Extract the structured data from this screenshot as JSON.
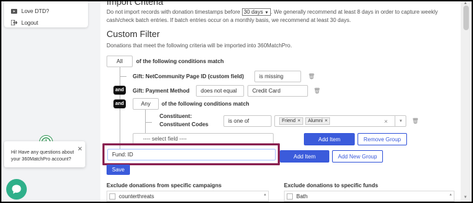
{
  "nav": {
    "love_label": "Love DTD?",
    "logout_label": "Logout"
  },
  "chat": {
    "message": "Hi! Have any questions about your 360MatchPro account?",
    "close_glyph": "✕"
  },
  "import_criteria": {
    "title": "Import Criteria",
    "text_before": "Do not import records with donation timestamps before",
    "days_select": "30 days",
    "text_after": ". We generally recommend at least 8 days in order to capture weekly cash/check batch entries. If batch entries occur on a monthly basis, we recommend at least 30 days."
  },
  "custom_filter": {
    "title": "Custom Filter",
    "description": "Donations that meet the following criteria will be imported into 360MatchPro.",
    "match_select": "All",
    "match_suffix": "of the following conditions match",
    "cond1": {
      "label": "Gift: NetCommunity Page ID (custom field)",
      "operator": "is missing"
    },
    "cond2": {
      "and_label": "and",
      "label": "Gift: Payment Method",
      "operator": "does not equal",
      "value": "Credit Card"
    },
    "group": {
      "and_label": "and",
      "match_select": "Any",
      "match_suffix": "of the following conditions match",
      "cond": {
        "label_line1": "Constituent:",
        "label_line2": "Constituent Codes",
        "operator": "is one of",
        "tags": [
          "Friend",
          "Alumni"
        ]
      },
      "select_placeholder": "---- select field ----",
      "add_item": "Add Item",
      "remove_group": "Remove Group"
    },
    "field_input": "Fund: ID",
    "add_item": "Add Item",
    "add_new_group": "Add New Group",
    "save": "Save"
  },
  "exclude_campaigns": {
    "label": "Exclude donations from specific campaigns",
    "first_item": "counterthreats"
  },
  "exclude_funds": {
    "label": "Exclude donations to specific funds",
    "first_item": "Bath"
  },
  "colors": {
    "primary": "#3b5bdb",
    "highlight": "#8b2252",
    "chat": "#2fb08a"
  }
}
